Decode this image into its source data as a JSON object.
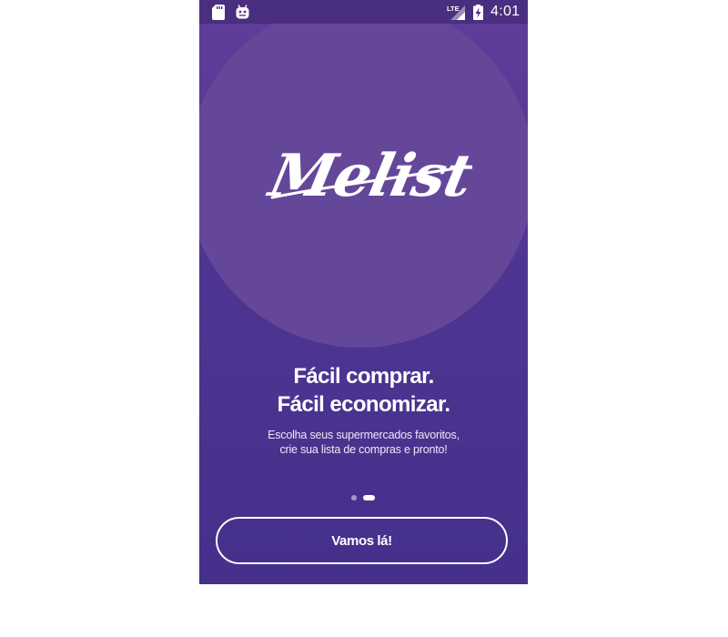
{
  "status_bar": {
    "time": "4:01",
    "network": "LTE",
    "icons": [
      "sd-card-icon",
      "android-debug-icon",
      "lte-signal-icon",
      "battery-charging-icon"
    ]
  },
  "brand": {
    "logo_text": "Melist",
    "primary_color": "#4f3592",
    "circle_color": "#65479a"
  },
  "onboarding": {
    "headline_line1": "Fácil comprar.",
    "headline_line2": "Fácil economizar.",
    "subtitle_line1": "Escolha seus supermercados favoritos,",
    "subtitle_line2": "crie sua lista de compras e pronto!",
    "page_indicator": {
      "total": 2,
      "current": 2
    },
    "cta_label": "Vamos lá!"
  }
}
